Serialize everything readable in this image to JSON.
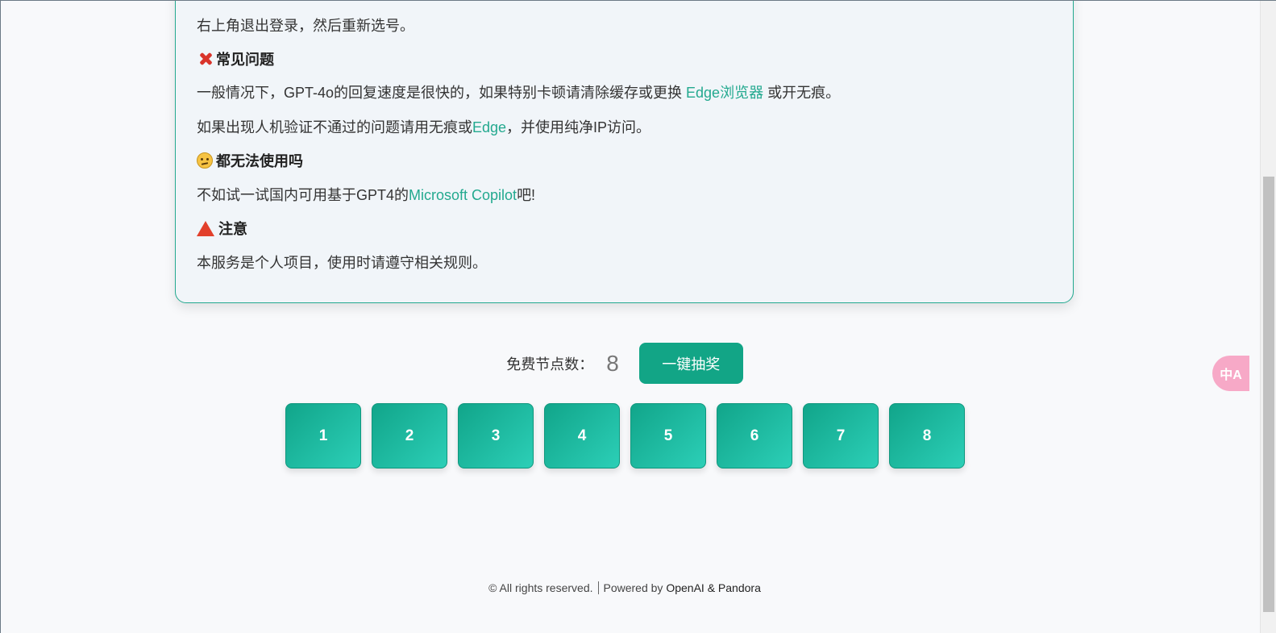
{
  "notice": {
    "line_logout": "右上角退出登录，然后重新选号。",
    "faq_title": "常见问题",
    "faq_line1_prefix": "一般情况下，GPT-4o的回复速度是很快的，如果特别卡顿请清除缓存或更换 ",
    "faq_line1_link": "Edge浏览器",
    "faq_line1_suffix": " 或开无痕。",
    "faq_line2_prefix": "如果出现人机验证不通过的问题请用无痕或",
    "faq_line2_link": "Edge",
    "faq_line2_suffix": "，并使用纯净IP访问。",
    "alt_title": "都无法使用吗",
    "alt_prefix": "不如试一试国内可用基于GPT4的",
    "alt_link": "Microsoft Copilot",
    "alt_suffix": "吧!",
    "warn_title": "注意",
    "warn_text": "本服务是个人项目，使用时请遵守相关规则。"
  },
  "lottery": {
    "label": "免费节点数：",
    "count": "8",
    "draw_button": "一键抽奖",
    "nodes": [
      "1",
      "2",
      "3",
      "4",
      "5",
      "6",
      "7",
      "8"
    ]
  },
  "footer": {
    "rights": "© All rights reserved.",
    "powered_prefix": "Powered by ",
    "brand": "OpenAI & Pandora"
  },
  "translate_button": "中A",
  "icons": {
    "faq": "cross-mark-icon",
    "alt": "thinking-face-icon",
    "warn": "warning-triangle-icon",
    "translate": "translate-icon"
  },
  "colors": {
    "accent": "#23a98f",
    "button": "#12a586"
  }
}
